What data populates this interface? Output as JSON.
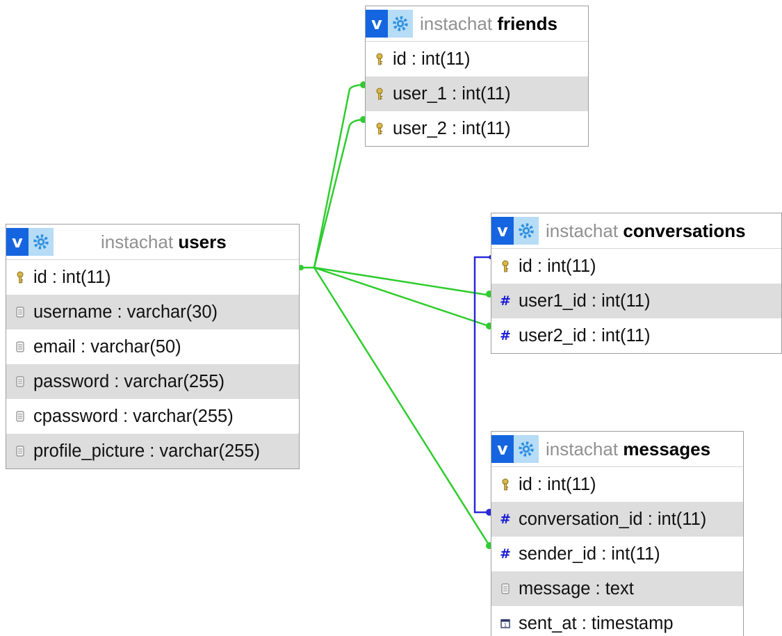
{
  "tables": {
    "friends": {
      "db": "instachat",
      "name": "friends",
      "fields": [
        {
          "label": "id : int(11)",
          "icon": "key-icon"
        },
        {
          "label": "user_1 : int(11)",
          "icon": "key-icon"
        },
        {
          "label": "user_2 : int(11)",
          "icon": "key-icon"
        }
      ]
    },
    "users": {
      "db": "instachat",
      "name": "users",
      "fields": [
        {
          "label": "id : int(11)",
          "icon": "key-icon"
        },
        {
          "label": "username : varchar(30)",
          "icon": "text-field-icon"
        },
        {
          "label": "email : varchar(50)",
          "icon": "text-field-icon"
        },
        {
          "label": "password : varchar(255)",
          "icon": "text-field-icon"
        },
        {
          "label": "cpassword : varchar(255)",
          "icon": "text-field-icon"
        },
        {
          "label": "profile_picture : varchar(255)",
          "icon": "text-field-icon"
        }
      ]
    },
    "conversations": {
      "db": "instachat",
      "name": "conversations",
      "fields": [
        {
          "label": "id : int(11)",
          "icon": "key-icon"
        },
        {
          "label": "user1_id : int(11)",
          "icon": "numeric-field-icon"
        },
        {
          "label": "user2_id : int(11)",
          "icon": "numeric-field-icon"
        }
      ]
    },
    "messages": {
      "db": "instachat",
      "name": "messages",
      "fields": [
        {
          "label": "id : int(11)",
          "icon": "key-icon"
        },
        {
          "label": "conversation_id : int(11)",
          "icon": "numeric-field-icon"
        },
        {
          "label": "sender_id : int(11)",
          "icon": "numeric-field-icon"
        },
        {
          "label": "message : text",
          "icon": "text-field-icon"
        },
        {
          "label": "sent_at : timestamp",
          "icon": "date-field-icon"
        }
      ]
    }
  },
  "header_buttons": {
    "toggle_label": "v",
    "options_icon": "gear-icon"
  },
  "relations": [
    {
      "from": "users.id",
      "to": "friends.user_1",
      "color": "#2ecc2e"
    },
    {
      "from": "users.id",
      "to": "friends.user_2",
      "color": "#2ecc2e"
    },
    {
      "from": "users.id",
      "to": "conversations.user1_id",
      "color": "#2ecc2e"
    },
    {
      "from": "users.id",
      "to": "conversations.user2_id",
      "color": "#2ecc2e"
    },
    {
      "from": "users.id",
      "to": "messages.sender_id",
      "color": "#2ecc2e"
    },
    {
      "from": "conversations.id",
      "to": "messages.conversation_id",
      "color": "#2a2ad6"
    }
  ],
  "colors": {
    "toggle_bg": "#1565e0",
    "options_bg": "#b6dcf6",
    "alt_row": "#dddddd",
    "key": "#c8a838",
    "numeric": "#1a1ad6"
  }
}
